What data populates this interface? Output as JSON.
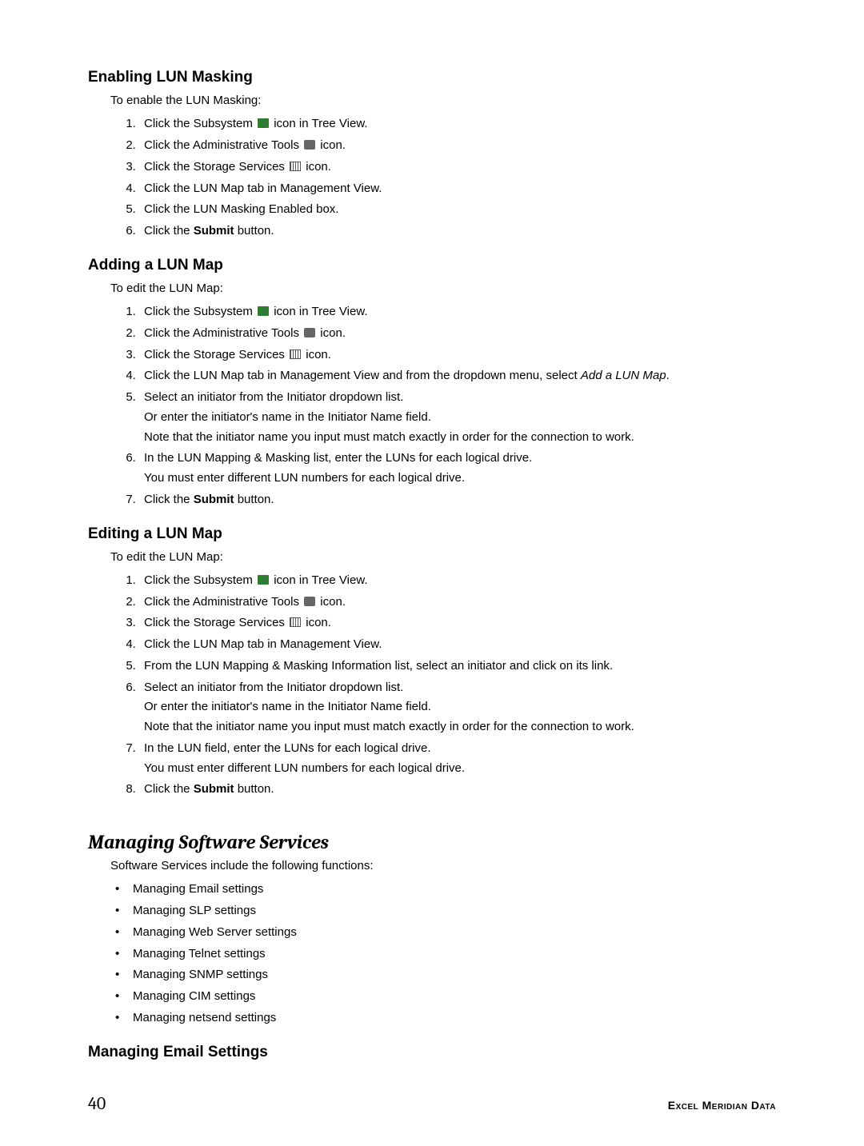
{
  "sections": {
    "enable": {
      "title": "Enabling LUN Masking",
      "intro": "To enable the LUN Masking:",
      "steps": {
        "s1a": "Click the Subsystem ",
        "s1b": " icon in Tree View.",
        "s2a": "Click the Administrative Tools ",
        "s2b": " icon.",
        "s3a": "Click the Storage Services ",
        "s3b": " icon.",
        "s4": "Click the LUN Map tab in Management View.",
        "s5": "Click the LUN Masking Enabled box.",
        "s6a": "Click the ",
        "s6bold": "Submit",
        "s6b": " button."
      }
    },
    "add": {
      "title": "Adding a LUN Map",
      "intro": "To edit the LUN Map:",
      "steps": {
        "s1a": "Click the Subsystem ",
        "s1b": " icon in Tree View.",
        "s2a": "Click the Administrative Tools ",
        "s2b": " icon.",
        "s3a": "Click the Storage Services ",
        "s3b": " icon.",
        "s4a": "Click the LUN Map tab in Management View and from the dropdown menu, select ",
        "s4italic": "Add a LUN Map",
        "s4b": ".",
        "s5a": "Select an initiator from the Initiator dropdown list.",
        "s5b": "Or enter the initiator's name in the Initiator Name field.",
        "s5c": "Note that the initiator name you input must match exactly in order for the connection to work.",
        "s6a": "In the LUN Mapping & Masking list, enter the LUNs for each logical drive.",
        "s6b": "You must enter different LUN numbers for each logical drive.",
        "s7a": "Click the ",
        "s7bold": "Submit",
        "s7b": " button."
      }
    },
    "edit": {
      "title": "Editing a LUN Map",
      "intro": "To edit the LUN Map:",
      "steps": {
        "s1a": "Click the Subsystem ",
        "s1b": " icon in Tree View.",
        "s2a": "Click the Administrative Tools ",
        "s2b": " icon.",
        "s3a": "Click the Storage Services ",
        "s3b": " icon.",
        "s4": "Click the LUN Map tab in Management View.",
        "s5": "From the LUN Mapping & Masking Information list, select an initiator and click on its link.",
        "s6a": "Select an initiator from the Initiator dropdown list.",
        "s6b": "Or enter the initiator's name in the Initiator Name field.",
        "s6c": "Note that the initiator name you input must match exactly in order for the connection to work.",
        "s7a": "In the LUN field, enter the LUNs for each logical drive.",
        "s7b": "You must enter different LUN numbers for each logical drive.",
        "s8a": "Click the ",
        "s8bold": "Submit",
        "s8b": " button."
      }
    },
    "sw": {
      "title": "Managing Software Services",
      "intro": "Software Services include the following functions:",
      "bullets": {
        "b1": "Managing Email settings",
        "b2": "Managing SLP settings",
        "b3": "Managing Web Server settings",
        "b4": "Managing Telnet settings",
        "b5": "Managing SNMP settings",
        "b6": "Managing CIM settings",
        "b7": "Managing netsend settings"
      }
    },
    "email": {
      "title": "Managing Email Settings"
    }
  },
  "footer": {
    "page": "40",
    "brand": "Excel Meridian Data"
  }
}
